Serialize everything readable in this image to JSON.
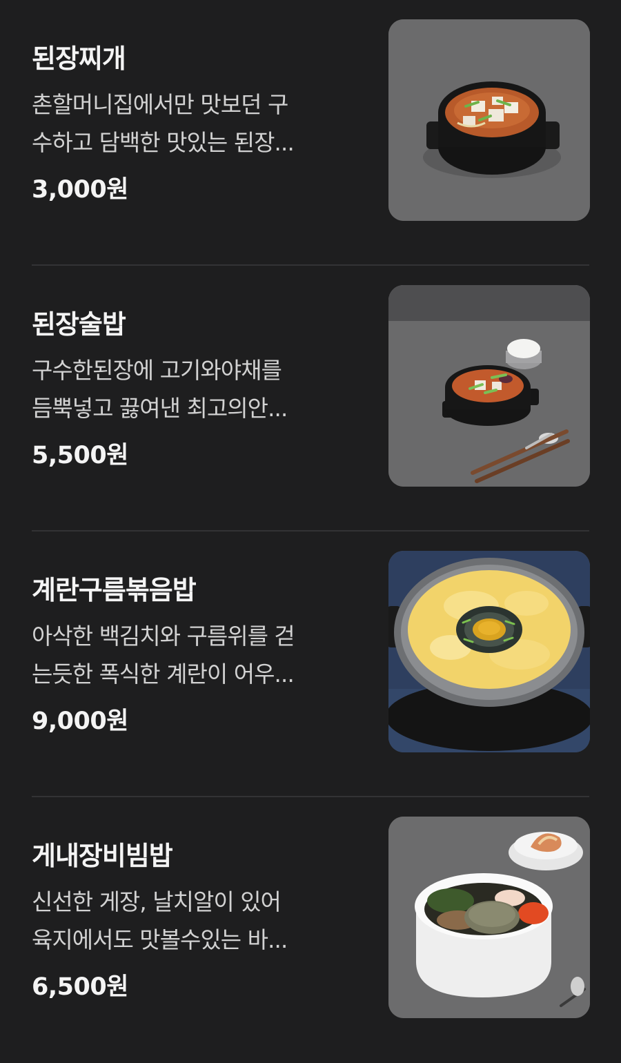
{
  "menu": {
    "items": [
      {
        "name": "된장찌개",
        "desc_line1": "촌할머니집에서만 맛보던 구",
        "desc_line2": "수하고 담백한 맛있는 된장...",
        "price": "3,000원",
        "image_icon": "doenjang-jjigae-photo"
      },
      {
        "name": "된장술밥",
        "desc_line1": "구수한된장에 고기와야채를",
        "desc_line2": "듬뿍넣고 끓여낸 최고의안...",
        "price": "5,500원",
        "image_icon": "doenjang-sulbap-photo"
      },
      {
        "name": "계란구름볶음밥",
        "desc_line1": "아삭한 백김치와 구름위를 걷",
        "desc_line2": "는듯한 폭식한 계란이 어우...",
        "price": "9,000원",
        "image_icon": "egg-cloud-fried-rice-photo"
      },
      {
        "name": "게내장비빔밥",
        "desc_line1": "신선한 게장, 날치알이 있어",
        "desc_line2": "육지에서도 맛볼수있는 바...",
        "price": "6,500원",
        "image_icon": "crab-bibimbap-photo"
      }
    ]
  },
  "colors": {
    "background": "#1e1e1f",
    "title": "#f4f4f4",
    "description": "#d2d2d2",
    "divider": "#333335"
  }
}
